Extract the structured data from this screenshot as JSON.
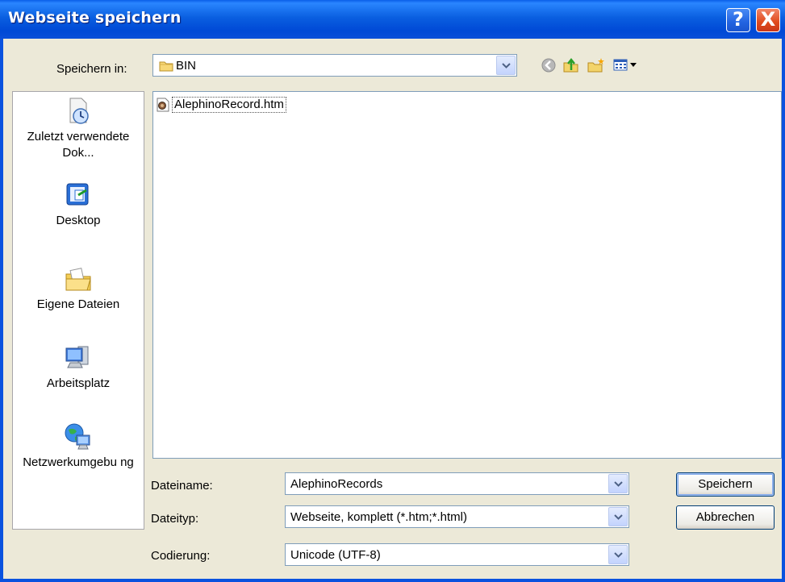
{
  "window": {
    "title": "Webseite speichern"
  },
  "titlebar_buttons": {
    "help": "?",
    "close": "X"
  },
  "save_in": {
    "label": "Speichern in:",
    "value": "BIN"
  },
  "toolbar": [
    "back-icon",
    "up-folder-icon",
    "new-folder-icon",
    "view-menu-icon"
  ],
  "places": [
    {
      "label": "Zuletzt verwendete Dok...",
      "icon": "recent-documents-icon"
    },
    {
      "label": "Desktop",
      "icon": "desktop-icon"
    },
    {
      "label": "Eigene Dateien",
      "icon": "my-documents-icon"
    },
    {
      "label": "Arbeitsplatz",
      "icon": "my-computer-icon"
    },
    {
      "label": "Netzwerkumgebu ng",
      "icon": "network-icon"
    }
  ],
  "files": [
    {
      "name": "AlephinoRecord.htm",
      "icon": "htm-file-icon"
    }
  ],
  "filename": {
    "label": "Dateiname:",
    "value": "AlephinoRecords"
  },
  "filetype": {
    "label": "Dateityp:",
    "value": "Webseite, komplett (*.htm;*.html)"
  },
  "encoding": {
    "label": "Codierung:",
    "value": "Unicode (UTF-8)"
  },
  "buttons": {
    "save": "Speichern",
    "cancel": "Abbrechen"
  },
  "colors": {
    "titlebar": "#0a52df",
    "dialog_bg": "#ece9d8",
    "field_border": "#7f9db9"
  }
}
